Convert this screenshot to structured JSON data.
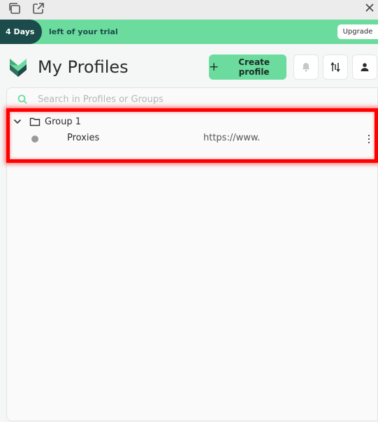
{
  "window": {
    "icons": [
      "duplicate-window-icon",
      "external-link-icon",
      "close-icon"
    ]
  },
  "trial": {
    "days": "4 Days",
    "text": "left of your trial",
    "upgrade_label": "Upgrade"
  },
  "header": {
    "title": "My Profiles",
    "create_label": "Create profile",
    "icons": [
      "bell-icon",
      "sort-filter-icon",
      "user-icon"
    ]
  },
  "search": {
    "placeholder": "Search in Profiles or Groups",
    "value": ""
  },
  "groups": [
    {
      "label": "Group 1",
      "expanded": true,
      "profiles": [
        {
          "name": "Proxies",
          "proxy": "https://www.",
          "status": "inactive"
        }
      ]
    }
  ],
  "colors": {
    "accent": "#6bdc9d",
    "brand_dark": "#1b4b4a",
    "highlight": "#ff0000",
    "status_dot": "#9a9a9a"
  }
}
